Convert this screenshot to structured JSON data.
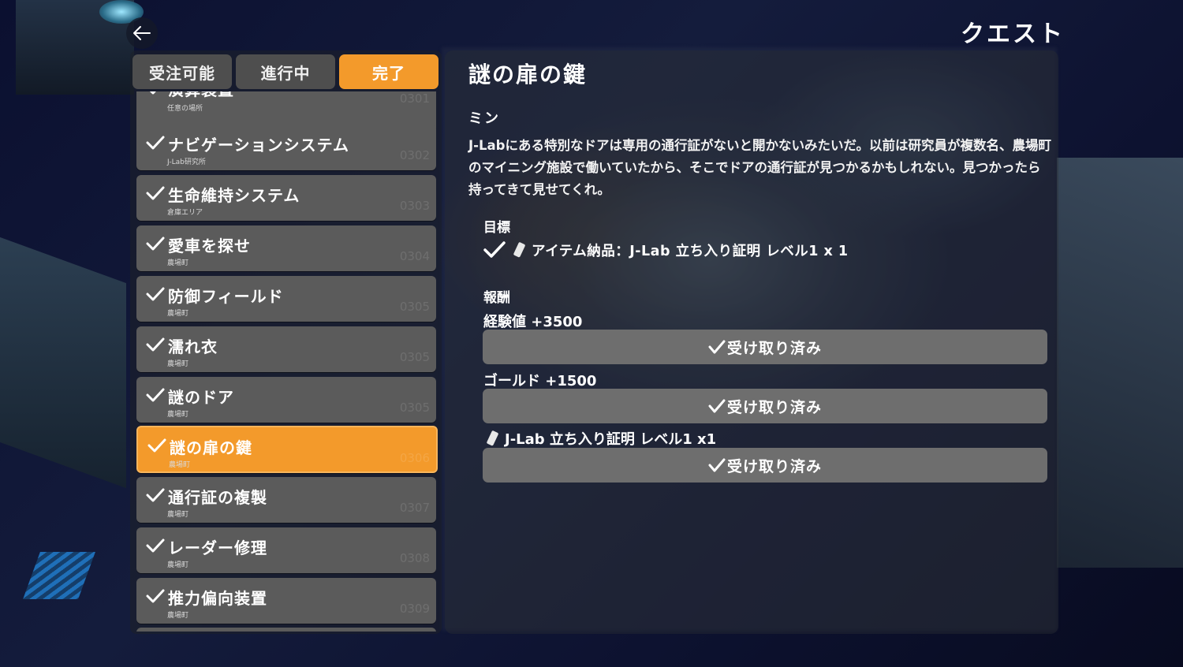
{
  "screen": {
    "title": "クエスト"
  },
  "tabs": [
    {
      "label": "受注可能",
      "active": false
    },
    {
      "label": "進行中",
      "active": false
    },
    {
      "label": "完了",
      "active": true
    }
  ],
  "quests": [
    {
      "name": "演算装置",
      "location": "任意の場所",
      "number": "0301"
    },
    {
      "name": "ナビゲーションシステム",
      "location": "J-Lab研究所",
      "number": "0302"
    },
    {
      "name": "生命維持システム",
      "location": "倉庫エリア",
      "number": "0303"
    },
    {
      "name": "愛車を探せ",
      "location": "農場町",
      "number": "0304"
    },
    {
      "name": "防御フィールド",
      "location": "農場町",
      "number": "0305"
    },
    {
      "name": "濡れ衣",
      "location": "農場町",
      "number": "0305"
    },
    {
      "name": "謎のドア",
      "location": "農場町",
      "number": "0305"
    },
    {
      "name": "謎の扉の鍵",
      "location": "農場町",
      "number": "0306"
    },
    {
      "name": "通行証の複製",
      "location": "農場町",
      "number": "0307"
    },
    {
      "name": "レーダー修理",
      "location": "農場町",
      "number": "0308"
    },
    {
      "name": "推力偏向装置",
      "location": "農場町",
      "number": "0309"
    }
  ],
  "detail": {
    "title": "謎の扉の鍵",
    "giver": "ミン",
    "description": "J-Labにある特別なドアは専用の通行証がないと開かないみたいだ。以前は研究員が複数名、農場町のマイニング施設で働いていたから、そこでドアの通行証が見つかるかもしれない。見つかったら持ってきて見せてくれ。",
    "objective_heading": "目標",
    "objective": "アイテム納品：J-Lab 立ち入り証明 レベル1 x 1",
    "rewards_heading": "報酬",
    "rewards": [
      {
        "label": "経験値 +3500",
        "button": "受け取り済み"
      },
      {
        "label": "ゴールド +1500",
        "button": "受け取り済み"
      },
      {
        "label": "J-Lab 立ち入り証明 レベル1 x1",
        "button": "受け取り済み"
      }
    ]
  },
  "colors": {
    "accent": "#f39a2b",
    "tab": "#4e4e4e",
    "item": "#5b5b5b",
    "claimed": "#6e6e6e"
  },
  "icons": {
    "back": "back-arrow-icon",
    "check": "check-icon",
    "item": "pass-card-icon"
  }
}
